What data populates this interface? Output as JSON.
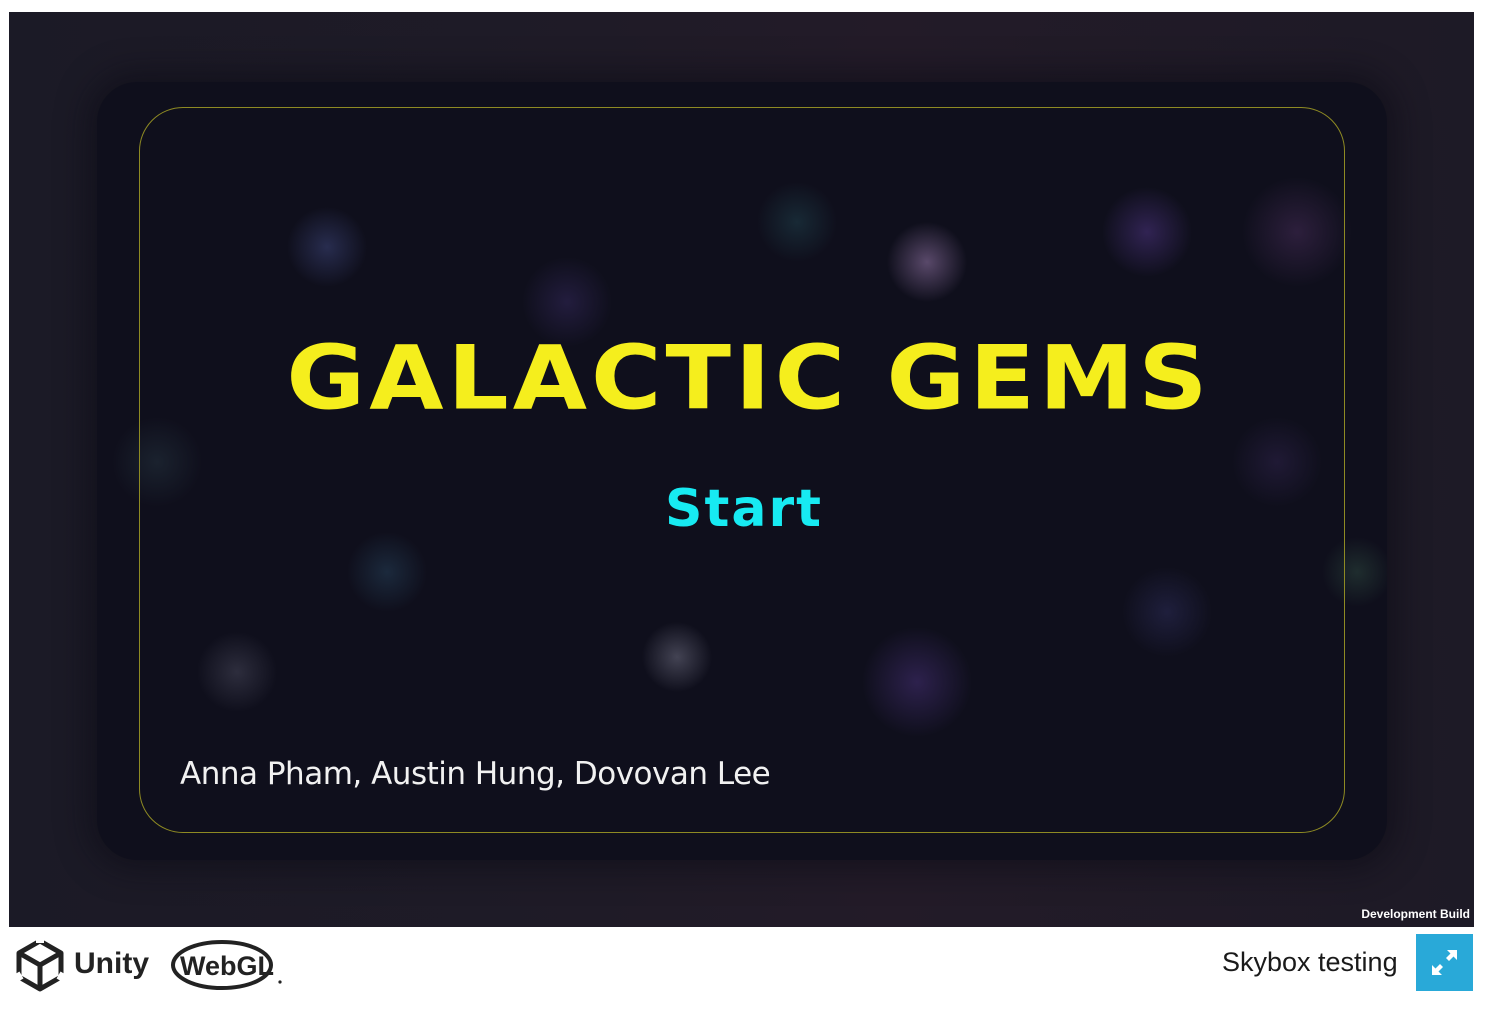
{
  "game": {
    "title": "GALACTIC GEMS",
    "start_label": "Start",
    "credits": "Anna Pham, Austin Hung, Dovovan Lee",
    "development_build": "Development Build"
  },
  "footer": {
    "unity_wordmark": "Unity",
    "webgl_text": "WebGL",
    "build_title": "Skybox testing",
    "fullscreen_icon": "fullscreen-expand-icon"
  },
  "colors": {
    "title": "#f5ee1d",
    "start": "#17eaf2",
    "frame": "#8e8a23",
    "fullscreen_button": "#29a9d8"
  }
}
